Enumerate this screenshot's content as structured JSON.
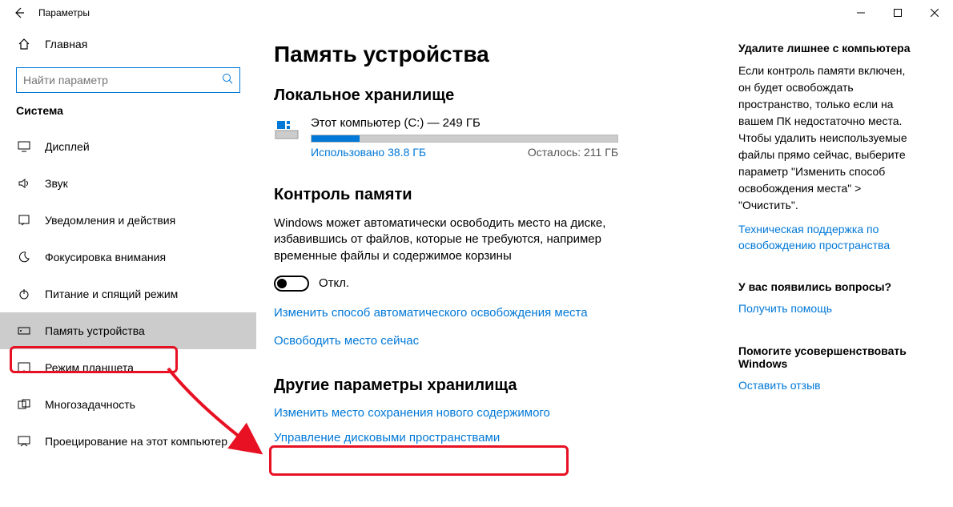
{
  "window": {
    "title": "Параметры"
  },
  "sidebar": {
    "home": "Главная",
    "search_placeholder": "Найти параметр",
    "group": "Система",
    "items": [
      {
        "label": "Дисплей"
      },
      {
        "label": "Звук"
      },
      {
        "label": "Уведомления и действия"
      },
      {
        "label": "Фокусировка внимания"
      },
      {
        "label": "Питание и спящий режим"
      },
      {
        "label": "Память устройства"
      },
      {
        "label": "Режим планшета"
      },
      {
        "label": "Многозадачность"
      },
      {
        "label": "Проецирование на этот компьютер"
      }
    ]
  },
  "page": {
    "title": "Память устройства",
    "storage_heading": "Локальное хранилище",
    "drive": {
      "name": "Этот компьютер (C:) — 249 ГБ",
      "used": "Использовано 38.8 ГБ",
      "free": "Осталось: 211 ГБ"
    },
    "sense_heading": "Контроль памяти",
    "sense_desc": "Windows может автоматически освободить место на диске, избавившись от файлов, которые не требуются, например временные файлы и содержимое корзины",
    "toggle_state": "Откл.",
    "link_change_auto": "Изменить способ автоматического освобождения места",
    "link_free_now": "Освободить место сейчас",
    "other_heading": "Другие параметры хранилища",
    "link_change_save": "Изменить место сохранения нового содержимого",
    "link_manage_spaces": "Управление дисковыми пространствами"
  },
  "right": {
    "tip_heading": "Удалите лишнее с компьютера",
    "tip_body": "Если контроль памяти включен, он будет освобождать пространство, только если на вашем ПК недостаточно места. Чтобы удалить неиспользуемые файлы прямо сейчас, выберите параметр \"Изменить способ освобождения места\" > \"Очистить\".",
    "tip_link": "Техническая поддержка по освобождению пространства",
    "q_heading": "У вас появились вопросы?",
    "q_link": "Получить помощь",
    "fb_heading": "Помогите усовершенствовать Windows",
    "fb_link": "Оставить отзыв"
  }
}
